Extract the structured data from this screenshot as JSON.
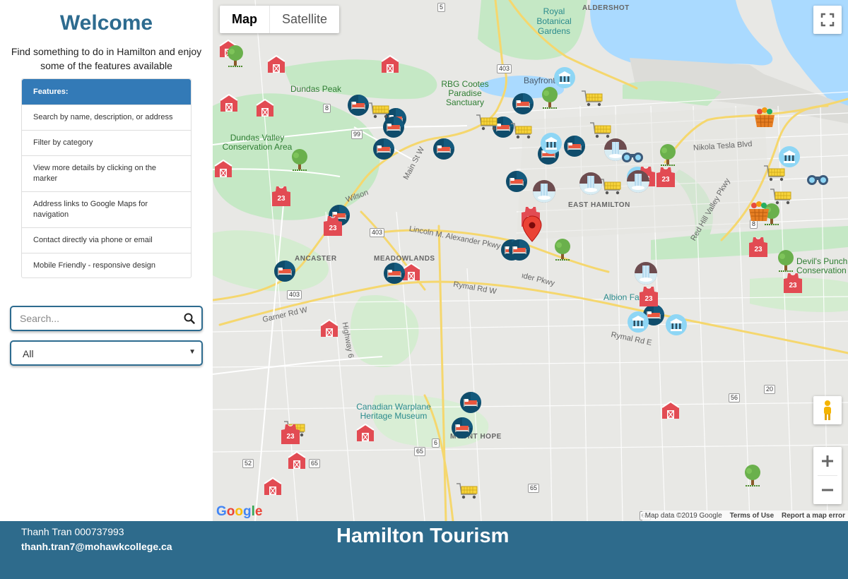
{
  "sidebar": {
    "welcome": "Welcome",
    "intro": "Find something to do in Hamilton and enjoy some of the features available",
    "features_header": "Features:",
    "features": [
      "Search by name, description, or address",
      "Filter by category",
      "View more details by clicking on the marker",
      "Address links to Google Maps for navigation",
      "Contact directly via phone or email",
      "Mobile Friendly - responsive design"
    ],
    "search_placeholder": "Search...",
    "category_selected": "All"
  },
  "map": {
    "type_buttons": {
      "map": "Map",
      "satellite": "Satellite"
    },
    "places": [
      "Royal Botanical Gardens",
      "ALDERSHOT",
      "Dundas Peak",
      "RBG Cootes Paradise Sanctuary",
      "Bayfront",
      "Dundas Valley Conservation Area",
      "Nikola Tesla Blvd",
      "EAST HAMILTON",
      "Wilson",
      "Main St W",
      "Lincoln M. Alexander Pkwy",
      "ANCASTER",
      "MEADOWLANDS",
      "Rymal Rd W",
      "Garner Rd W",
      "Highway 6",
      "Albion Falls",
      "Rymal Rd E",
      "Red Hill Valley Pkwy",
      "Devil's Punch Conservation",
      "Canadian Warplane Heritage Museum",
      "MOUNT HOPE"
    ],
    "route_shields": [
      "5",
      "403",
      "8",
      "99",
      "403",
      "403",
      "8",
      "20",
      "56",
      "6",
      "65",
      "52",
      "65",
      "65",
      "65"
    ],
    "attribution": {
      "copyright": "Map data ©2019 Google",
      "terms": "Terms of Use",
      "report": "Report a map error"
    },
    "logo": "Google",
    "markers": [
      {
        "type": "barn"
      },
      {
        "type": "barn"
      },
      {
        "type": "barn"
      },
      {
        "type": "barn"
      },
      {
        "type": "barn"
      },
      {
        "type": "barn"
      },
      {
        "type": "barn"
      },
      {
        "type": "barn"
      },
      {
        "type": "barn"
      },
      {
        "type": "barn"
      },
      {
        "type": "barn"
      },
      {
        "type": "barn"
      },
      {
        "type": "hotel"
      },
      {
        "type": "hotel"
      },
      {
        "type": "hotel"
      },
      {
        "type": "hotel"
      },
      {
        "type": "hotel"
      },
      {
        "type": "hotel"
      },
      {
        "type": "hotel"
      },
      {
        "type": "hotel"
      },
      {
        "type": "hotel"
      },
      {
        "type": "hotel"
      },
      {
        "type": "hotel"
      },
      {
        "type": "hotel"
      },
      {
        "type": "hotel"
      },
      {
        "type": "hotel"
      },
      {
        "type": "hotel"
      },
      {
        "type": "hotel"
      },
      {
        "type": "hotel"
      },
      {
        "type": "hotel"
      },
      {
        "type": "cart"
      },
      {
        "type": "cart"
      },
      {
        "type": "cart"
      },
      {
        "type": "cart"
      },
      {
        "type": "cart"
      },
      {
        "type": "cart"
      },
      {
        "type": "cart"
      },
      {
        "type": "cart"
      },
      {
        "type": "cart"
      },
      {
        "type": "cart"
      },
      {
        "type": "tree"
      },
      {
        "type": "tree"
      },
      {
        "type": "tree"
      },
      {
        "type": "tree"
      },
      {
        "type": "tree"
      },
      {
        "type": "tree"
      },
      {
        "type": "tree"
      },
      {
        "type": "tree"
      },
      {
        "type": "museum"
      },
      {
        "type": "museum"
      },
      {
        "type": "museum"
      },
      {
        "type": "museum"
      },
      {
        "type": "museum"
      },
      {
        "type": "museum"
      },
      {
        "type": "jersey",
        "label": "23"
      },
      {
        "type": "jersey",
        "label": "23"
      },
      {
        "type": "jersey",
        "label": "23"
      },
      {
        "type": "jersey",
        "label": "23"
      },
      {
        "type": "jersey",
        "label": "23"
      },
      {
        "type": "jersey",
        "label": "23"
      },
      {
        "type": "jersey",
        "label": "23"
      },
      {
        "type": "jersey",
        "label": "23"
      },
      {
        "type": "jersey",
        "label": "23"
      },
      {
        "type": "waterfall"
      },
      {
        "type": "waterfall"
      },
      {
        "type": "waterfall"
      },
      {
        "type": "waterfall"
      },
      {
        "type": "waterfall"
      },
      {
        "type": "basket"
      },
      {
        "type": "basket"
      },
      {
        "type": "binoculars"
      },
      {
        "type": "binoculars"
      },
      {
        "type": "pin"
      }
    ]
  },
  "footer": {
    "author": "Thanh Tran 000737993",
    "email": "thanh.tran7@mohawkcollege.ca",
    "title": "Hamilton Tourism"
  },
  "colors": {
    "accent": "#2d6b8f",
    "footer_bg": "#2e6b8c",
    "panel_header": "#337ab7",
    "water": "#aadaff",
    "park": "#c5e8c5"
  }
}
